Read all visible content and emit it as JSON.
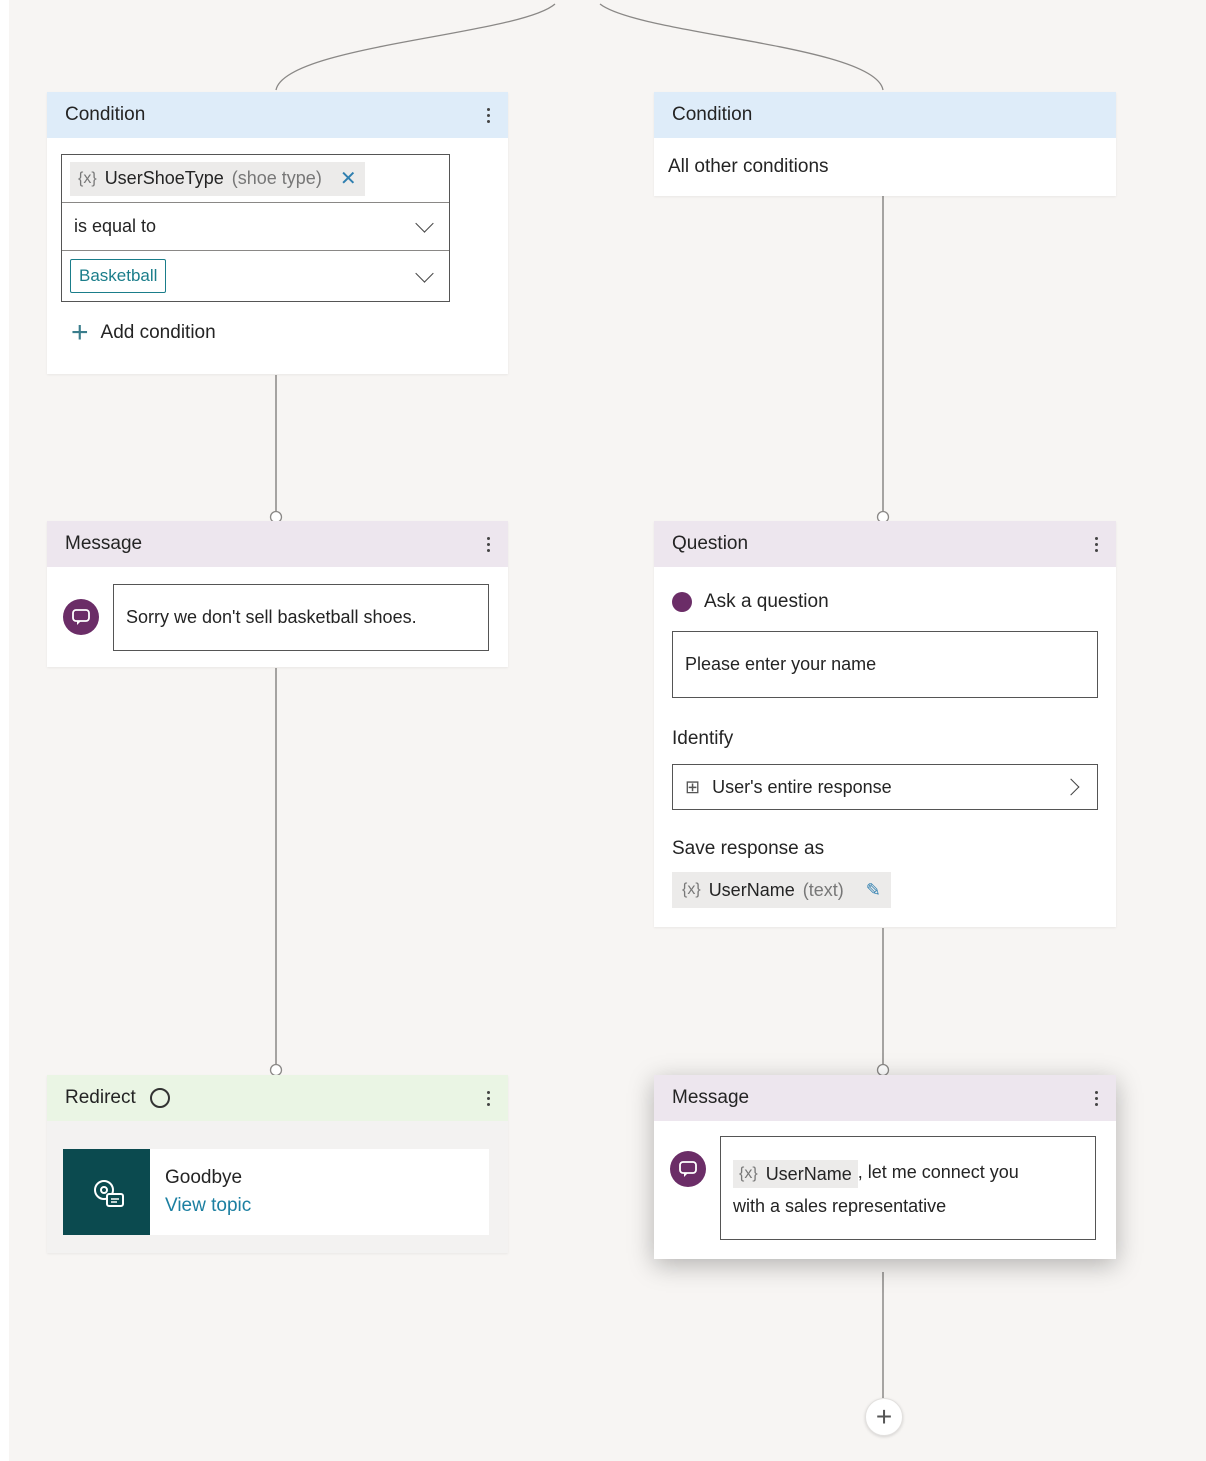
{
  "left_branch": {
    "condition": {
      "title": "Condition",
      "variable_icon": "{x}",
      "variable_name": "UserShoeType",
      "variable_type": "(shoe type)",
      "remove_glyph": "✕",
      "operator": "is equal to",
      "value": "Basketball",
      "add_condition": "Add condition"
    },
    "message": {
      "title": "Message",
      "text": "Sorry we don't sell basketball shoes."
    },
    "redirect": {
      "title": "Redirect",
      "topic_name": "Goodbye",
      "view_topic": "View topic"
    }
  },
  "right_branch": {
    "condition": {
      "title": "Condition",
      "text": "All other conditions"
    },
    "question": {
      "title": "Question",
      "ask_label": "Ask a question",
      "prompt": "Please enter your name",
      "identify_label": "Identify",
      "identify_value": "User's entire response",
      "save_label": "Save response as",
      "variable_icon": "{x}",
      "variable_name": "UserName",
      "variable_type": "(text)"
    },
    "message": {
      "title": "Message",
      "variable_icon": "{x}",
      "variable_name": "UserName",
      "text_after": ", let me connect you",
      "text_line2": "with a sales representative"
    }
  },
  "add_node": "+",
  "colors": {
    "condition_header": "#deecf9",
    "message_header": "#ede6ee",
    "redirect_header": "#eaf5e4",
    "bot_icon": "#6b2d67",
    "topic_tile": "#0b4a4f",
    "link": "#1b7fa1"
  }
}
